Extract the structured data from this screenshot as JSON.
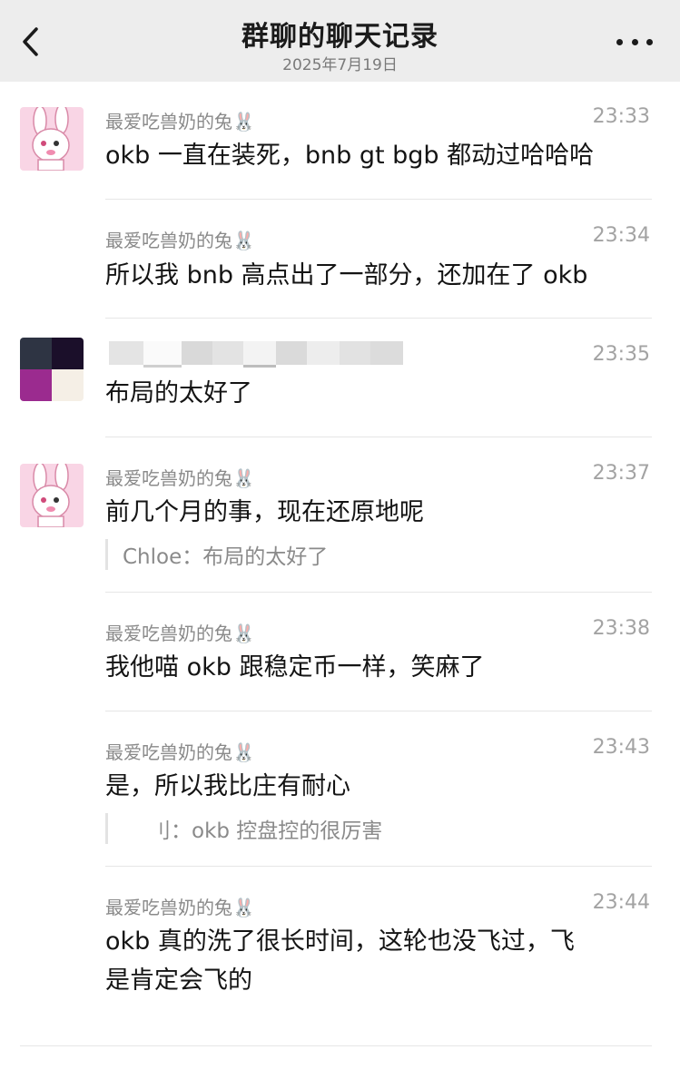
{
  "header": {
    "title": "群聊的聊天记录",
    "date": "2025年7月19日"
  },
  "messages": [
    {
      "sender": "最爱吃兽奶的兔🐰",
      "time": "23:33",
      "text": "okb 一直在装死，bnb gt bgb 都动过哈哈哈"
    },
    {
      "sender": "最爱吃兽奶的兔🐰",
      "time": "23:34",
      "text": "所以我 bnb 高点出了一部分，还加在了 okb"
    },
    {
      "sender": "",
      "time": "23:35",
      "text": "布局的太好了"
    },
    {
      "sender": "最爱吃兽奶的兔🐰",
      "time": "23:37",
      "text": "前几个月的事，现在还原地呢",
      "quote": "Chloe：布局的太好了"
    },
    {
      "sender": "最爱吃兽奶的兔🐰",
      "time": "23:38",
      "text": "我他喵 okb 跟稳定币一样，笑麻了"
    },
    {
      "sender": "最爱吃兽奶的兔🐰",
      "time": "23:43",
      "text": "是，所以我比庄有耐心",
      "quote": "刂：okb 控盘控的很厉害"
    },
    {
      "sender": "最爱吃兽奶的兔🐰",
      "time": "23:44",
      "text": "okb 真的洗了很长时间，这轮也没飞过，飞\n是肯定会飞的"
    }
  ],
  "colors": {
    "header_bg": "#ededed",
    "avatar_pink": "#f7c9de",
    "separator": "#e6e6e6"
  },
  "icons": {
    "back": "chevron-left-icon",
    "more": "more-dots-icon",
    "rabbit_avatar": "pink-rabbit-avatar",
    "pixel_avatar": "pixel-avatar"
  }
}
